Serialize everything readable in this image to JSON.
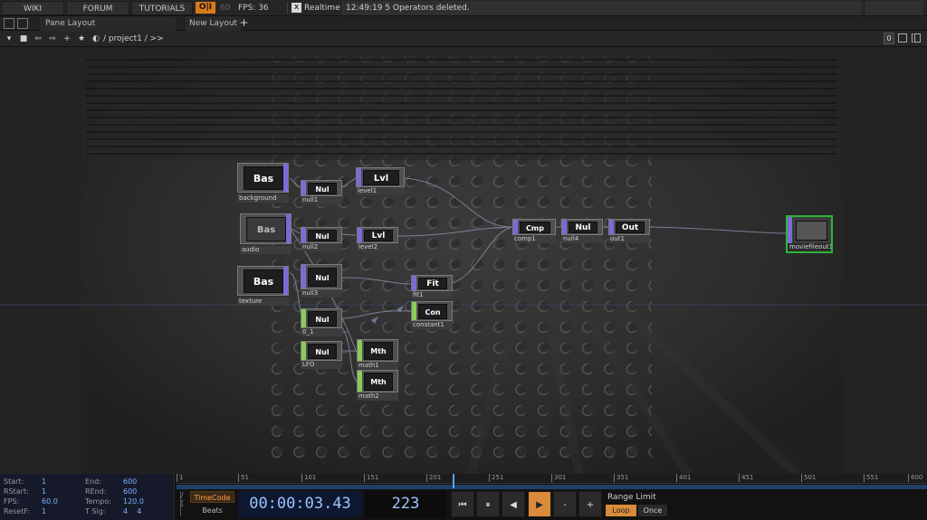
{
  "topbar": {
    "wiki": "WIKI",
    "forum": "FORUM",
    "tutorials": "TUTORIALS",
    "oii": "O|I",
    "fps_cap": "60",
    "fps_label": "FPS:  36",
    "realtime_check": "x",
    "realtime_label": "Realtime",
    "status_message": "12:49:19 5 Operators deleted."
  },
  "layoutbar": {
    "pane_layout": "Pane Layout",
    "new_layout": "New Layout",
    "add": "+"
  },
  "pathbar": {
    "path": "/ project1 / >>",
    "right_zero": "0"
  },
  "nodes": [
    {
      "id": "background",
      "title": "Bas",
      "label": "background",
      "family": "top"
    },
    {
      "id": "audio",
      "title": "Bas",
      "label": "audio",
      "family": "top"
    },
    {
      "id": "texture",
      "title": "Bas",
      "label": "texture",
      "family": "top"
    },
    {
      "id": "null1",
      "title": "Nul",
      "label": "null1",
      "family": "top"
    },
    {
      "id": "null2",
      "title": "Nul",
      "label": "null2",
      "family": "top"
    },
    {
      "id": "null3",
      "title": "Nul",
      "label": "null3",
      "family": "top"
    },
    {
      "id": "level1",
      "title": "Lvl",
      "label": "level1",
      "family": "top"
    },
    {
      "id": "level2",
      "title": "Lvl",
      "label": "level2",
      "family": "top"
    },
    {
      "id": "fit1",
      "title": "Fit",
      "label": "fit1",
      "family": "top"
    },
    {
      "id": "constant1",
      "title": "Con",
      "label": "constant1",
      "family": "chop"
    },
    {
      "id": "n01",
      "title": "Nul",
      "label": "0_1",
      "family": "chop"
    },
    {
      "id": "lfo",
      "title": "Nul",
      "label": "LFO",
      "family": "chop"
    },
    {
      "id": "math1",
      "title": "Mth",
      "label": "math1",
      "family": "chop"
    },
    {
      "id": "math2",
      "title": "Mth",
      "label": "math2",
      "family": "chop"
    },
    {
      "id": "comp1",
      "title": "Cmp",
      "label": "comp1",
      "family": "top"
    },
    {
      "id": "null4",
      "title": "Nul",
      "label": "null4",
      "family": "top"
    },
    {
      "id": "out1",
      "title": "Out",
      "label": "out1",
      "family": "top"
    },
    {
      "id": "moviefileout1",
      "title": "",
      "label": "moviefileout1",
      "family": "top"
    }
  ],
  "timeline": {
    "info": {
      "start_key": "Start:",
      "start_val": "1",
      "rstart_key": "RStart:",
      "rstart_val": "1",
      "fps_key": "FPS:",
      "fps_val": "60.0",
      "resetf_key": "ResetF:",
      "resetf_val": "1",
      "end_key": "End:",
      "end_val": "600",
      "rend_key": "REnd:",
      "rend_val": "600",
      "tempo_key": "Tempo:",
      "tempo_val": "120.0",
      "tsig_key": "T Sig:",
      "tsig_val": "4    4"
    },
    "ticks": [
      "1",
      "51",
      "101",
      "151",
      "201",
      "251",
      "301",
      "351",
      "401",
      "451",
      "501",
      "551",
      "600"
    ],
    "timecode_label": "TimeCode",
    "beats_label": "Beats",
    "timecode": "00:00:03.43",
    "frame": "223",
    "btn_rewind": "⏮",
    "btn_pause": "⏸",
    "btn_back": "◀",
    "btn_play": "▶",
    "btn_minus": "-",
    "btn_plus": "+",
    "range_limit": "Range Limit",
    "loop": "Loop",
    "once": "Once"
  },
  "colors": {
    "accent_orange": "#d98a3a",
    "top_family": "#7c6ad8",
    "chop_family": "#8acb5a",
    "timecode_blue": "#9cc3ff",
    "selected_node": "#2fb33a"
  }
}
